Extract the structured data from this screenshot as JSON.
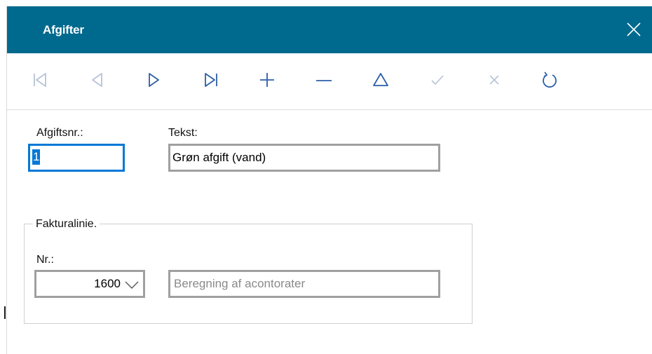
{
  "window": {
    "title": "Afgifter"
  },
  "toolbar": {
    "buttons": [
      {
        "name": "first-record",
        "icon": "skip-first-icon",
        "enabled": false
      },
      {
        "name": "prev-record",
        "icon": "triangle-left-icon",
        "enabled": false
      },
      {
        "name": "next-record",
        "icon": "triangle-right-icon",
        "enabled": true
      },
      {
        "name": "last-record",
        "icon": "skip-last-icon",
        "enabled": true
      },
      {
        "name": "add-record",
        "icon": "plus-icon",
        "enabled": true
      },
      {
        "name": "delete-record",
        "icon": "minus-icon",
        "enabled": true
      },
      {
        "name": "edit-record",
        "icon": "triangle-up-icon",
        "enabled": true
      },
      {
        "name": "confirm",
        "icon": "check-icon",
        "enabled": false
      },
      {
        "name": "cancel",
        "icon": "x-icon",
        "enabled": false
      },
      {
        "name": "refresh",
        "icon": "refresh-icon",
        "enabled": true
      }
    ]
  },
  "form": {
    "afgiftsnr_label": "Afgiftsnr.:",
    "afgiftsnr_value": "1",
    "tekst_label": "Tekst:",
    "tekst_value": "Grøn afgift (vand)",
    "group_title": "Fakturalinie.",
    "nr_label": "Nr.:",
    "nr_value": "1600",
    "nr_description": "Beregning af acontorater"
  },
  "colors": {
    "titlebar": "#006a8e",
    "focus": "#0078d7",
    "icon_enabled": "#2b5fa8",
    "icon_disabled": "#b7c3d6",
    "field_border": "#a0a0a0"
  }
}
